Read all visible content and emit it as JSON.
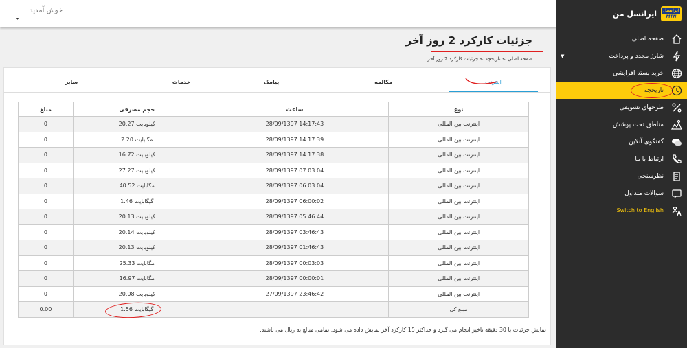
{
  "topbar": {
    "welcome": "خوش آمدید",
    "dropdown_mark": "▾"
  },
  "sidebar": {
    "brand_name": "ایرانسل من",
    "logo_top": "ایرانسل",
    "logo_bottom": "MTN",
    "items": [
      {
        "label": "صفحه اصلی",
        "icon": "home-icon"
      },
      {
        "label": "شارژ مجدد و پرداخت",
        "icon": "bolt-icon",
        "has_submenu": true
      },
      {
        "label": "خرید بسته افزایشی",
        "icon": "globe-icon"
      },
      {
        "label": "تاریخچه",
        "icon": "history-icon",
        "active": true
      },
      {
        "label": "طرحهای تشویقی",
        "icon": "percent-icon"
      },
      {
        "label": "مناطق تحت پوشش",
        "icon": "map-icon"
      },
      {
        "label": "گفتگوی آنلاین",
        "icon": "chat-icon"
      },
      {
        "label": "ارتباط با ما",
        "icon": "phone-icon"
      },
      {
        "label": "نظرسنجی",
        "icon": "survey-icon"
      },
      {
        "label": "سوالات متداول",
        "icon": "faq-icon"
      },
      {
        "label": "Switch to English",
        "icon": "translate-icon",
        "english": true
      }
    ]
  },
  "page": {
    "title": "جزئیات کارکرد 2 روز آخر",
    "breadcrumb": "صفحه اصلی > تاریخچه > جزئیات کارکرد 2 روز آخر"
  },
  "tabs": [
    {
      "label": "اینترنت",
      "active": true
    },
    {
      "label": "مکالمه"
    },
    {
      "label": "پیامک"
    },
    {
      "label": "خدمات"
    },
    {
      "label": "سایر"
    }
  ],
  "table": {
    "headers": {
      "type": "نوع",
      "time": "ساعت",
      "volume": "حجم مصرفی",
      "amount": "مبلغ"
    },
    "rows": [
      {
        "type": "اینترنت بین المللی",
        "time": "28/09/1397 14:17:43",
        "volume": "20.27 کیلوبایت",
        "amount": "0"
      },
      {
        "type": "اینترنت بین المللی",
        "time": "28/09/1397 14:17:39",
        "volume": "2.20 مگابایت",
        "amount": "0"
      },
      {
        "type": "اینترنت بین المللی",
        "time": "28/09/1397 14:17:38",
        "volume": "16.72 کیلوبایت",
        "amount": "0"
      },
      {
        "type": "اینترنت بین المللی",
        "time": "28/09/1397 07:03:04",
        "volume": "27.27 کیلوبایت",
        "amount": "0"
      },
      {
        "type": "اینترنت بین المللی",
        "time": "28/09/1397 06:03:04",
        "volume": "40.52 مگابایت",
        "amount": "0"
      },
      {
        "type": "اینترنت بین المللی",
        "time": "28/09/1397 06:00:02",
        "volume": "1.46 گیگابایت",
        "amount": "0"
      },
      {
        "type": "اینترنت بین المللی",
        "time": "28/09/1397 05:46:44",
        "volume": "20.13 کیلوبایت",
        "amount": "0"
      },
      {
        "type": "اینترنت بین المللی",
        "time": "28/09/1397 03:46:43",
        "volume": "20.14 کیلوبایت",
        "amount": "0"
      },
      {
        "type": "اینترنت بین المللی",
        "time": "28/09/1397 01:46:43",
        "volume": "20.13 کیلوبایت",
        "amount": "0"
      },
      {
        "type": "اینترنت بین المللی",
        "time": "28/09/1397 00:03:03",
        "volume": "25.33 مگابایت",
        "amount": "0"
      },
      {
        "type": "اینترنت بین المللی",
        "time": "28/09/1397 00:00:01",
        "volume": "16.97 مگابایت",
        "amount": "0"
      },
      {
        "type": "اینترنت بین المللی",
        "time": "27/09/1397 23:46:42",
        "volume": "20.08 کیلوبایت",
        "amount": "0"
      }
    ],
    "total": {
      "label": "مبلغ کل",
      "volume": "1.56 گیگابایت",
      "amount": "0.00"
    }
  },
  "footnote": "نمایش جزئیات با 30 دقیقه تاخیر انجام می گیرد و حداکثر 15 کارکرد آخر نمایش داده می شود. تمامی مبالغ به ریال می باشند.",
  "colors": {
    "accent": "#fdcb0b",
    "sidebar": "#2c2c2c",
    "tab_active": "#2a9fd6",
    "annotation": "#e02020"
  }
}
